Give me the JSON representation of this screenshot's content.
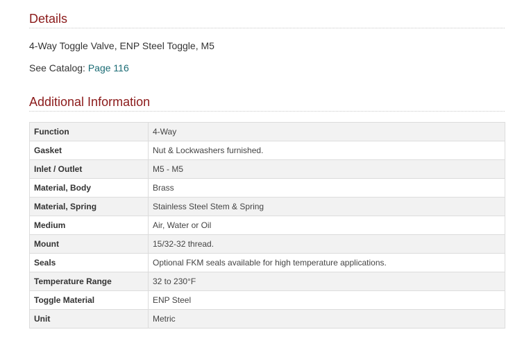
{
  "details": {
    "title": "Details",
    "description": "4-Way Toggle Valve, ENP Steel Toggle, M5",
    "catalog_prefix": "See Catalog:",
    "catalog_link": "Page 116"
  },
  "additional": {
    "title": "Additional Information",
    "rows": [
      {
        "label": "Function",
        "value": "4-Way"
      },
      {
        "label": "Gasket",
        "value": "Nut & Lockwashers furnished."
      },
      {
        "label": "Inlet / Outlet",
        "value": "M5 - M5"
      },
      {
        "label": "Material, Body",
        "value": "Brass"
      },
      {
        "label": "Material, Spring",
        "value": "Stainless Steel Stem & Spring"
      },
      {
        "label": "Medium",
        "value": "Air, Water or Oil"
      },
      {
        "label": "Mount",
        "value": "15/32-32 thread."
      },
      {
        "label": "Seals",
        "value": "Optional FKM seals available for high temperature applications."
      },
      {
        "label": "Temperature Range",
        "value": "32 to 230°F"
      },
      {
        "label": "Toggle Material",
        "value": "ENP Steel"
      },
      {
        "label": "Unit",
        "value": "Metric"
      }
    ]
  },
  "colors": {
    "heading": "#8b1a1a",
    "link": "#1a6b74",
    "row_alt": "#f2f2f2",
    "border": "#dcdcdc"
  }
}
